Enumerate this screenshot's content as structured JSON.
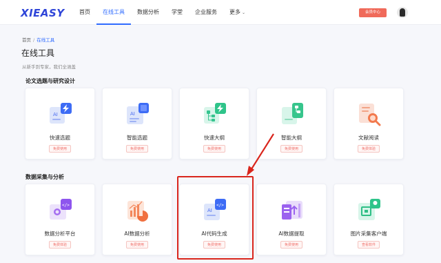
{
  "header": {
    "logo": "XIEASY",
    "nav": [
      {
        "label": "首页"
      },
      {
        "label": "在线工具"
      },
      {
        "label": "数据分析"
      },
      {
        "label": "学堂"
      },
      {
        "label": "企业服务"
      },
      {
        "label": "更多"
      }
    ],
    "active_nav": "在线工具",
    "vip_label": "会员中心"
  },
  "breadcrumb": {
    "home": "首页",
    "separator": "/",
    "current": "在线工具"
  },
  "page": {
    "title": "在线工具",
    "subtitle": "从新手到专家，我们全涵盖"
  },
  "sections": [
    {
      "title": "论文选题与研究设计",
      "cards": [
        {
          "name": "快速选题",
          "action": "免费使用",
          "icon": "ai-lightning-icon"
        },
        {
          "name": "智能选题",
          "action": "免费使用",
          "icon": "ai-document-icon"
        },
        {
          "name": "快速大纲",
          "action": "免费使用",
          "icon": "outline-lightning-icon"
        },
        {
          "name": "智能大纲",
          "action": "免费使用",
          "icon": "outline-tree-icon"
        },
        {
          "name": "文献阅读",
          "action": "免费体验",
          "icon": "document-search-icon"
        }
      ]
    },
    {
      "title": "数据采集与分析",
      "cards": [
        {
          "name": "数据分析平台",
          "action": "免费体验",
          "icon": "code-search-icon"
        },
        {
          "name": "AI数据分析",
          "action": "免费使用",
          "icon": "bar-chart-icon"
        },
        {
          "name": "AI代码生成",
          "action": "免费使用",
          "icon": "ai-code-icon"
        },
        {
          "name": "AI数据提取",
          "action": "免费使用",
          "icon": "data-extract-icon"
        },
        {
          "name": "图片采集客户端",
          "action": "查看软件",
          "icon": "image-capture-icon"
        }
      ]
    }
  ],
  "colors": {
    "brand": "#2f45d8",
    "accent": "#2f6bff",
    "vip": "#f06a5a",
    "highlight": "#d9251c",
    "action": "#f0706a"
  }
}
